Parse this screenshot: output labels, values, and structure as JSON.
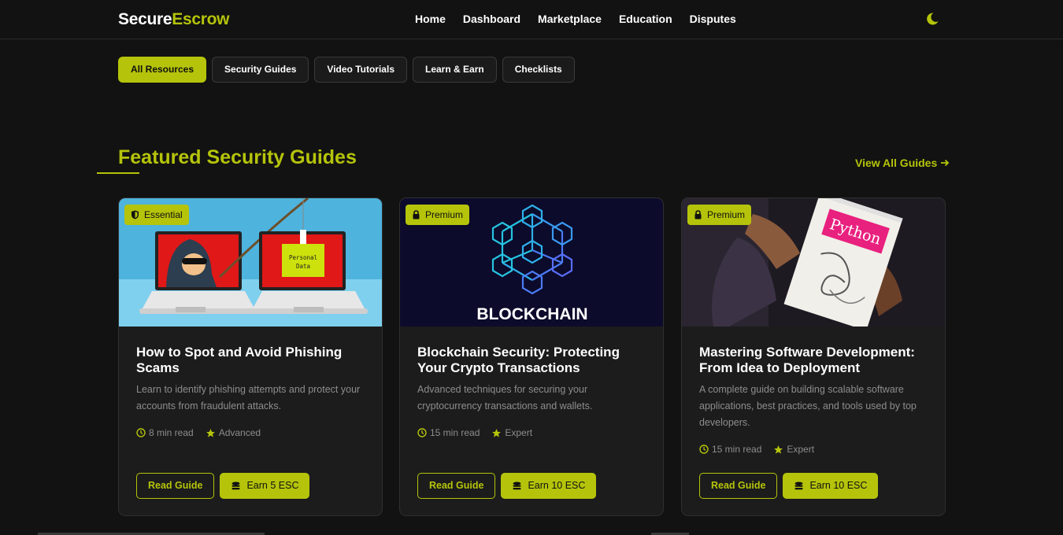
{
  "brand": {
    "part1": "Secure",
    "part2": "Escrow",
    "accent": "#b5c40a"
  },
  "nav": {
    "links": [
      "Home",
      "Dashboard",
      "Marketplace",
      "Education",
      "Disputes"
    ],
    "theme_toggle_icon": "moon-icon"
  },
  "filters": {
    "tabs": [
      "All Resources",
      "Security Guides",
      "Video Tutorials",
      "Learn & Earn",
      "Checklists"
    ],
    "active": "All Resources"
  },
  "section": {
    "title": "Featured Security Guides",
    "view_all": "View All Guides"
  },
  "cards": [
    {
      "badge": "Essential",
      "badge_icon": "shield-icon",
      "image": {
        "screen_left": "Personal",
        "screen_right": "Data"
      },
      "title": "How to Spot and Avoid Phishing Scams",
      "description": "Learn to identify phishing attempts and protect your accounts from fraudulent attacks.",
      "read_time": "8 min read",
      "level": "Advanced",
      "read_label": "Read Guide",
      "earn_label": "Earn 5 ESC"
    },
    {
      "badge": "Premium",
      "badge_icon": "lock-icon",
      "image": {
        "word": "BLOCKCHAIN"
      },
      "title": "Blockchain Security: Protecting Your Crypto Transactions",
      "description": "Advanced techniques for securing your cryptocurrency transactions and wallets.",
      "read_time": "15 min read",
      "level": "Expert",
      "read_label": "Read Guide",
      "earn_label": "Earn 10 ESC"
    },
    {
      "badge": "Premium",
      "badge_icon": "lock-icon",
      "image": {
        "book_title": "Python"
      },
      "title": "Mastering Software Development: From Idea to Deployment",
      "description": "A complete guide on building scalable software applications, best practices, and tools used by top developers.",
      "read_time": "15 min read",
      "level": "Expert",
      "read_label": "Read Guide",
      "earn_label": "Earn 10 ESC"
    }
  ]
}
